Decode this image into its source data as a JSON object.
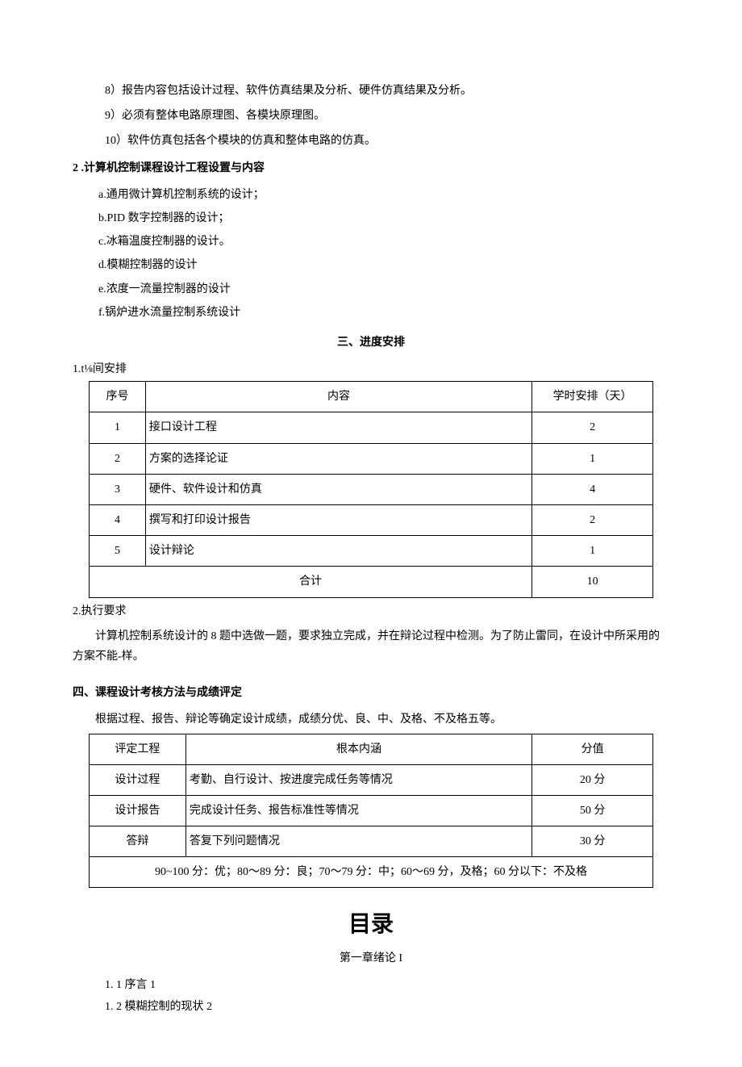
{
  "items_top": [
    "8）报告内容包括设计过程、软件仿真结果及分析、硬件仿真结果及分析。",
    "9）必须有整体电路原理图、各模块原理图。",
    "10）软件仿真包括各个模块的仿真和整体电路的仿真。"
  ],
  "section2_heading": "2    .计算机控制课程设计工程设置与内容",
  "section2_items": [
    "a.通用微计算机控制系统的设计；",
    "b.PID 数字控制器的设计；",
    "c.冰箱温度控制器的设计。",
    "d.模糊控制器的设计",
    "e.浓度一流量控制器的设计",
    "f.锅炉进水流量控制系统设计"
  ],
  "section3_title": "三、进度安排",
  "schedule": {
    "caption": "1.t⅛间安排",
    "headers": [
      "序号",
      "内容",
      "学时安排（天）"
    ],
    "rows": [
      {
        "seq": "1",
        "content": "接口设计工程",
        "days": "2"
      },
      {
        "seq": "2",
        "content": "方案的选择论证",
        "days": "1"
      },
      {
        "seq": "3",
        "content": "硬件、软件设计和仿真",
        "days": "4"
      },
      {
        "seq": "4",
        "content": "撰写和打印设计报告",
        "days": "2"
      },
      {
        "seq": "5",
        "content": "设计辩论",
        "days": "1"
      }
    ],
    "total_label": "合计",
    "total_value": "10"
  },
  "exec_req_heading": "2.执行要求",
  "exec_req_para": "计算机控制系统设计的 8 题中选做一题，要求独立完成，并在辩论过程中检测。为了防止雷同，在设计中所采用的方案不能-样。",
  "section4_heading": "四、课程设计考核方法与成绩评定",
  "section4_intro": "根据过程、报告、辩论等确定设计成绩，成绩分优、良、中、及格、不及格五等。",
  "grading": {
    "headers": [
      "评定工程",
      "根本内涵",
      "分值"
    ],
    "rows": [
      {
        "item": "设计过程",
        "desc": "考勤、自行设计、按进度完成任务等情况",
        "score": "20 分"
      },
      {
        "item": "设计报告",
        "desc": "完成设计任务、报告标准性等情况",
        "score": "50 分"
      },
      {
        "item": "答辩",
        "desc": "答复下列问题情况",
        "score": "30 分"
      }
    ],
    "footer": "90~100 分：优；80～89 分：良；70～79 分：中；60～69 分，及格；60 分以下：不及格"
  },
  "toc": {
    "title": "目录",
    "chapter": "第一章绪论 I",
    "items": [
      "1. 1 序言 1",
      "1. 2  模糊控制的现状 2"
    ]
  }
}
